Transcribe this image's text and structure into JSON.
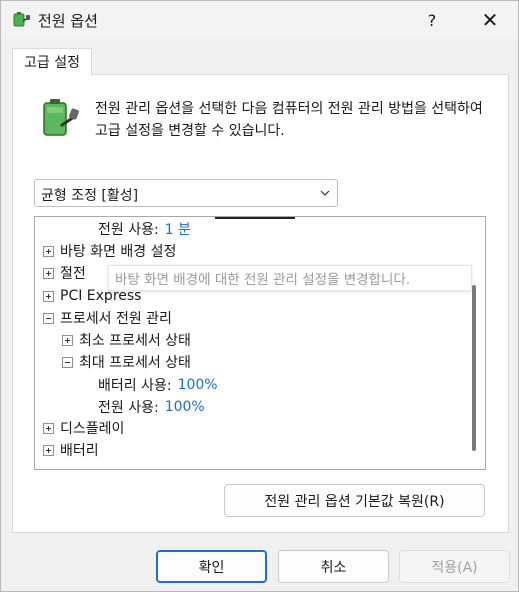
{
  "window": {
    "title": "전원 옵션",
    "help_glyph": "?",
    "close_glyph": "✕"
  },
  "tab": {
    "label": "고급 설정"
  },
  "description": "전원 관리 옵션을 선택한 다음 컴퓨터의 전원 관리 방법을 선택하여 고급 설정을 변경할 수 있습니다.",
  "plan_dropdown": {
    "selected": "균형 조정 [활성]"
  },
  "tree": {
    "rows": [
      {
        "label": "전원 사용:",
        "value": "1 분"
      },
      {
        "label": "바탕 화면 배경 설정"
      },
      {
        "label": "절전"
      },
      {
        "label": "PCI Express"
      },
      {
        "label": "프로세서 전원 관리"
      },
      {
        "label": "최소 프로세서 상태"
      },
      {
        "label": "최대 프로세서 상태"
      },
      {
        "label": "배터리 사용:",
        "value": "100%"
      },
      {
        "label": "전원 사용:",
        "value": "100%"
      },
      {
        "label": "디스플레이"
      },
      {
        "label": "배터리"
      }
    ],
    "tooltip": "바탕 화면 배경에 대한 전원 관리 설정을 변경합니다."
  },
  "buttons": {
    "restore": "전원 관리 옵션 기본값 복원(R)",
    "ok": "확인",
    "cancel": "취소",
    "apply": "적용(A)"
  },
  "colors": {
    "value_blue": "#1a6fc8",
    "accent": "#1a6fc8"
  }
}
